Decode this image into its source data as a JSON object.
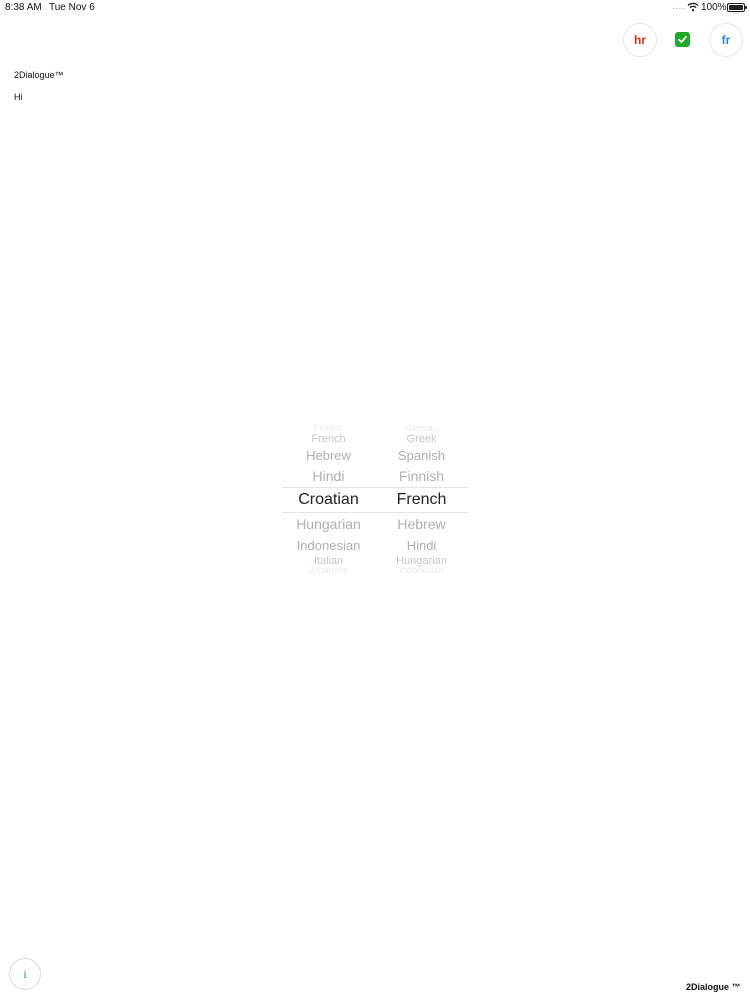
{
  "status_bar": {
    "time": "8:38 AM",
    "date": "Tue Nov 6",
    "signal": "....",
    "battery": "100%",
    "icons": [
      "wifi-icon",
      "battery-icon"
    ]
  },
  "header": {
    "source_language_code": "hr",
    "target_language_code": "fr",
    "confirm_icon": "check-icon",
    "colors": {
      "source": "#d0341f",
      "target": "#2b87c8",
      "confirm": "#1fa82b"
    }
  },
  "content": {
    "app_title": "2Dialogue™",
    "message": "Hi"
  },
  "picker": {
    "left_column": {
      "items": [
        "Finnish",
        "French",
        "Hebrew",
        "Hindi",
        "Croatian",
        "Hungarian",
        "Indonesian",
        "Italian",
        "Japanese"
      ],
      "selected": "Croatian"
    },
    "right_column": {
      "items": [
        "German",
        "Greek",
        "Spanish",
        "Finnish",
        "French",
        "Hebrew",
        "Hindi",
        "Hungarian",
        "Indonesian"
      ],
      "selected": "French"
    }
  },
  "footer": {
    "info_label": "i",
    "brand": "2Dialogue ™"
  }
}
